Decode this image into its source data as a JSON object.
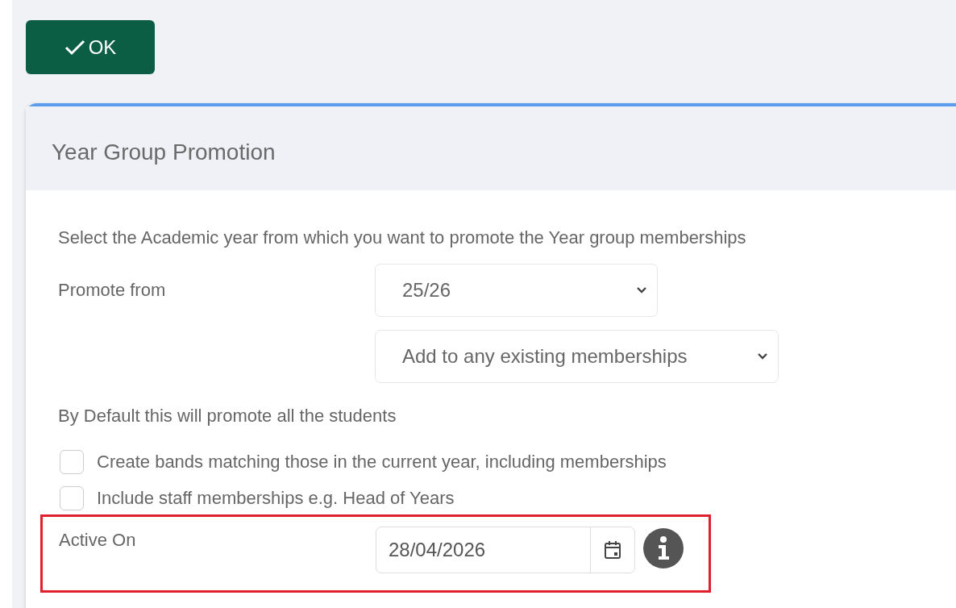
{
  "ok_button": {
    "label": "OK"
  },
  "panel": {
    "title": "Year Group Promotion"
  },
  "intro": "Select the Academic year from which you want to promote the Year group memberships",
  "promote_from": {
    "label": "Promote from",
    "value": "25/26"
  },
  "membership_mode": {
    "value": "Add to any existing memberships"
  },
  "default_note": "By Default this will promote all the students",
  "options": [
    {
      "label": "Create bands matching those in the current year, including memberships",
      "checked": false
    },
    {
      "label": "Include staff memberships e.g. Head of Years",
      "checked": false
    }
  ],
  "active_on": {
    "label": "Active On",
    "value": "28/04/2026",
    "highlighted": true
  }
}
